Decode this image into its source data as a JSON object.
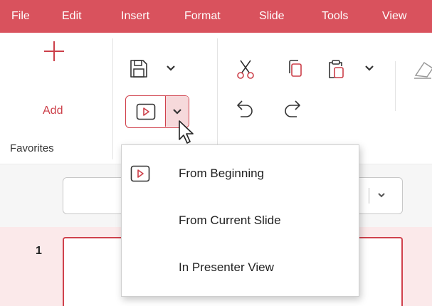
{
  "menu": {
    "items": [
      "File",
      "Edit",
      "Insert",
      "Format",
      "Slide",
      "Tools",
      "View"
    ]
  },
  "ribbon": {
    "add_label": "Add",
    "favorites_label": "Favorites"
  },
  "dropdown": {
    "items": [
      {
        "label": "From Beginning",
        "icon": "play-slideshow-icon"
      },
      {
        "label": "From Current Slide"
      },
      {
        "label": "In Presenter View"
      }
    ]
  },
  "slides": {
    "current_number": "1"
  },
  "colors": {
    "accent": "#d9525d",
    "accent_dark": "#cc3f49",
    "menu_text": "#ffffff",
    "slide_panel_bg": "#fbe9ea"
  }
}
